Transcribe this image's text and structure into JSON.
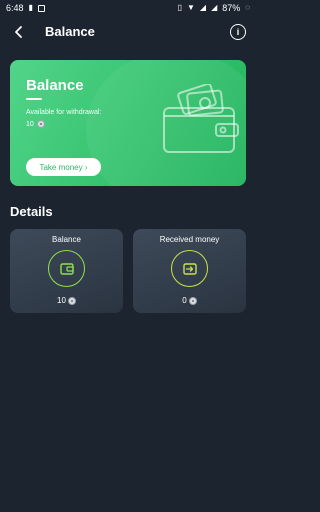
{
  "status_bar": {
    "time": "6:48",
    "battery": "87%"
  },
  "header": {
    "title": "Balance",
    "back_icon": "back-arrow-icon",
    "info_icon": "info-icon"
  },
  "balance_card": {
    "title": "Balance",
    "withdraw_label": "Available for withdrawal:",
    "withdraw_value": "10",
    "take_money_label": "Take money ›",
    "colors": {
      "gradient_start": "#52d48a",
      "gradient_end": "#20b35c"
    }
  },
  "details": {
    "title": "Details",
    "cards": [
      {
        "label": "Balance",
        "value": "10",
        "icon": "wallet-icon"
      },
      {
        "label": "Received money",
        "value": "0",
        "icon": "deposit-icon"
      }
    ]
  },
  "colors": {
    "background": "#1c2430",
    "accent": "#8ee24a"
  }
}
